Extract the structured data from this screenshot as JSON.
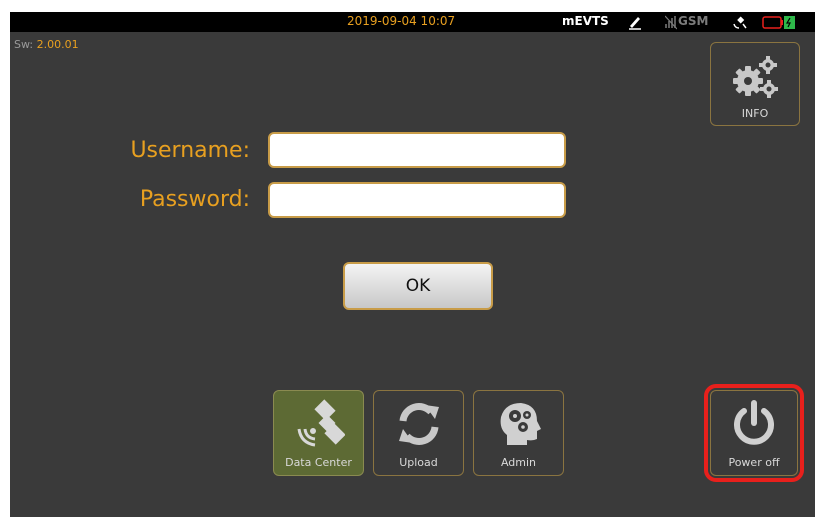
{
  "statusbar": {
    "datetime": "2019-09-04 10:07",
    "app_name": "mEVTS",
    "network_label": "GSM",
    "icons": [
      "pen-signature-icon",
      "no-signal-icon",
      "satellite-icon",
      "battery-icon"
    ]
  },
  "software": {
    "label": "Sw:",
    "version": "2.00.01"
  },
  "info_button": {
    "label": "INFO",
    "icon": "gears-icon"
  },
  "login": {
    "username_label": "Username:",
    "username_value": "",
    "password_label": "Password:",
    "password_value": "",
    "ok_label": "OK"
  },
  "apps": [
    {
      "label": "Data Center",
      "icon": "satellite-icon",
      "active": true
    },
    {
      "label": "Upload",
      "icon": "sync-icon",
      "active": false
    },
    {
      "label": "Admin",
      "icon": "head-gears-icon",
      "active": false
    }
  ],
  "power_button": {
    "label": "Power off",
    "icon": "power-icon",
    "highlighted": true
  },
  "colors": {
    "accent": "#e8a020",
    "background": "#3a3a3a",
    "statusbar": "#000000",
    "active_tile": "#5d6a34",
    "highlight": "#e8201c"
  }
}
